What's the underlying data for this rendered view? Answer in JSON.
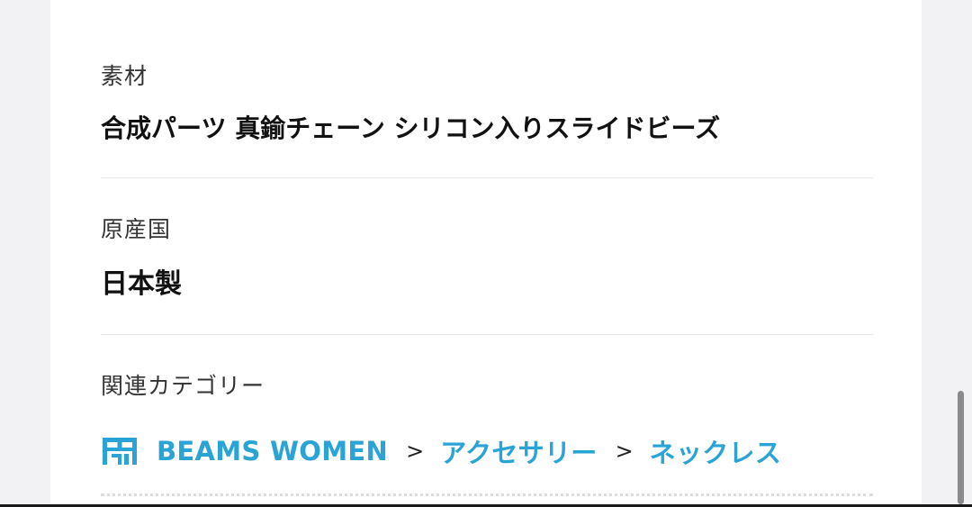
{
  "details": {
    "material": {
      "label": "素材",
      "value": "合成パーツ 真鍮チェーン シリコン入りスライドビーズ"
    },
    "origin": {
      "label": "原産国",
      "value": "日本製"
    },
    "related": {
      "label": "関連カテゴリー",
      "icon": "shop-icon",
      "crumbs": [
        "BEAMS WOMEN",
        "アクセサリー",
        "ネックレス"
      ],
      "separator": ">"
    }
  },
  "colors": {
    "link": "#2aa3d6",
    "text": "#111111",
    "background": "#f2f2f4"
  }
}
